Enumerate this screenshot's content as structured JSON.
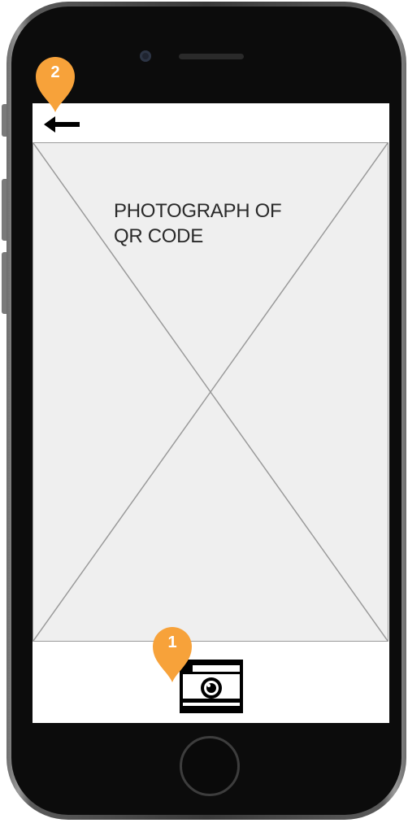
{
  "screen": {
    "back_icon": "arrow-left-icon",
    "photo_label_line1": "PHOTOGRAPH OF",
    "photo_label_line2": "QR CODE",
    "camera_icon": "camera-icon"
  },
  "annotations": [
    {
      "number": "1",
      "target": "camera-button"
    },
    {
      "number": "2",
      "target": "back-button"
    }
  ],
  "colors": {
    "marker": "#f7a23a",
    "placeholder_bg": "#efefef",
    "placeholder_line": "#9a9a9a",
    "phone_body": "#0c0c0c"
  }
}
